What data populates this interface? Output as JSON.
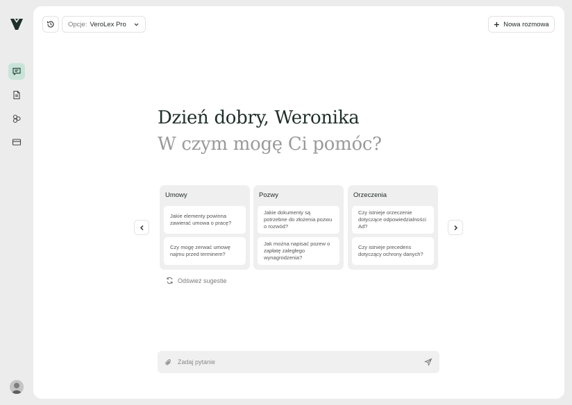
{
  "header": {
    "model_label": "Opcje:",
    "model_value": "VeroLex Pro",
    "new_chat_label": "Nowa rozmowa"
  },
  "hero": {
    "greeting": "Dzień dobry, Weronika",
    "subtitle": "W czym mogę Ci pomóc?"
  },
  "suggestions": {
    "categories": [
      {
        "title": "Umowy",
        "questions": [
          "Jakie elementy powinna zawierać umowa o pracę?",
          "Czy mogę zerwać umowę najmu przed terminem?"
        ]
      },
      {
        "title": "Pozwy",
        "questions": [
          "Jakie dokumenty są potrzebne do złożenia pozwu o rozwód?",
          "Jak można napisać pozew o zapłatę zaległego wynagrodzenia?"
        ]
      },
      {
        "title": "Orzeczenia",
        "questions": [
          "Czy istnieje orzeczenie dotyczące odpowiedzialności Ad?",
          "Czy istnieje precedens dotyczący ochrony danych?"
        ]
      }
    ],
    "refresh_label": "Odśwież sugestie"
  },
  "composer": {
    "placeholder": "Zadaj pytanie"
  },
  "colors": {
    "accent_active": "#c9e3d9",
    "heading": "#1f2f2a",
    "muted": "#9a9a9a"
  }
}
